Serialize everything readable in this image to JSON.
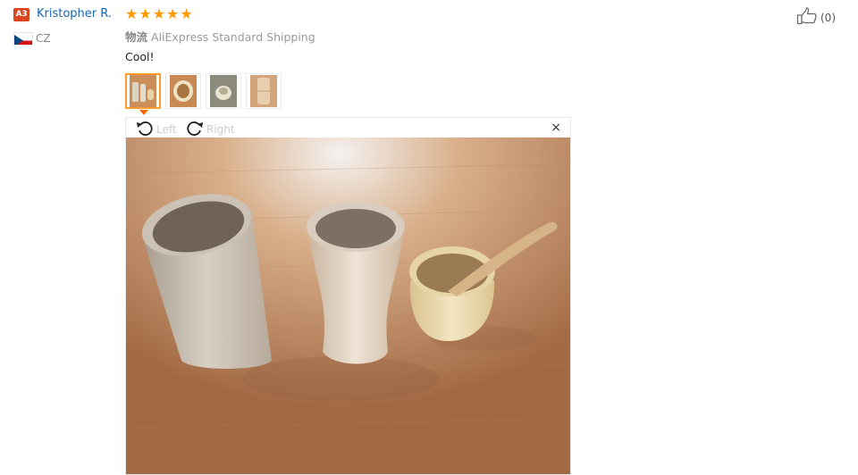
{
  "user": {
    "level": "A3",
    "name": "Kristopher R.",
    "country": "CZ"
  },
  "review": {
    "stars": [
      "★",
      "★",
      "★",
      "★",
      "★"
    ],
    "shipping_label": "物流",
    "shipping_method": "AliExpress Standard Shipping",
    "text": "Cool!"
  },
  "helpful": {
    "count": "(0)"
  },
  "viewer": {
    "rotate_left": "Left",
    "rotate_right": "Right",
    "close": "×"
  },
  "colors": {
    "accent": "#ff9a00",
    "link": "#1a66b2",
    "badge": "#d9451e"
  }
}
